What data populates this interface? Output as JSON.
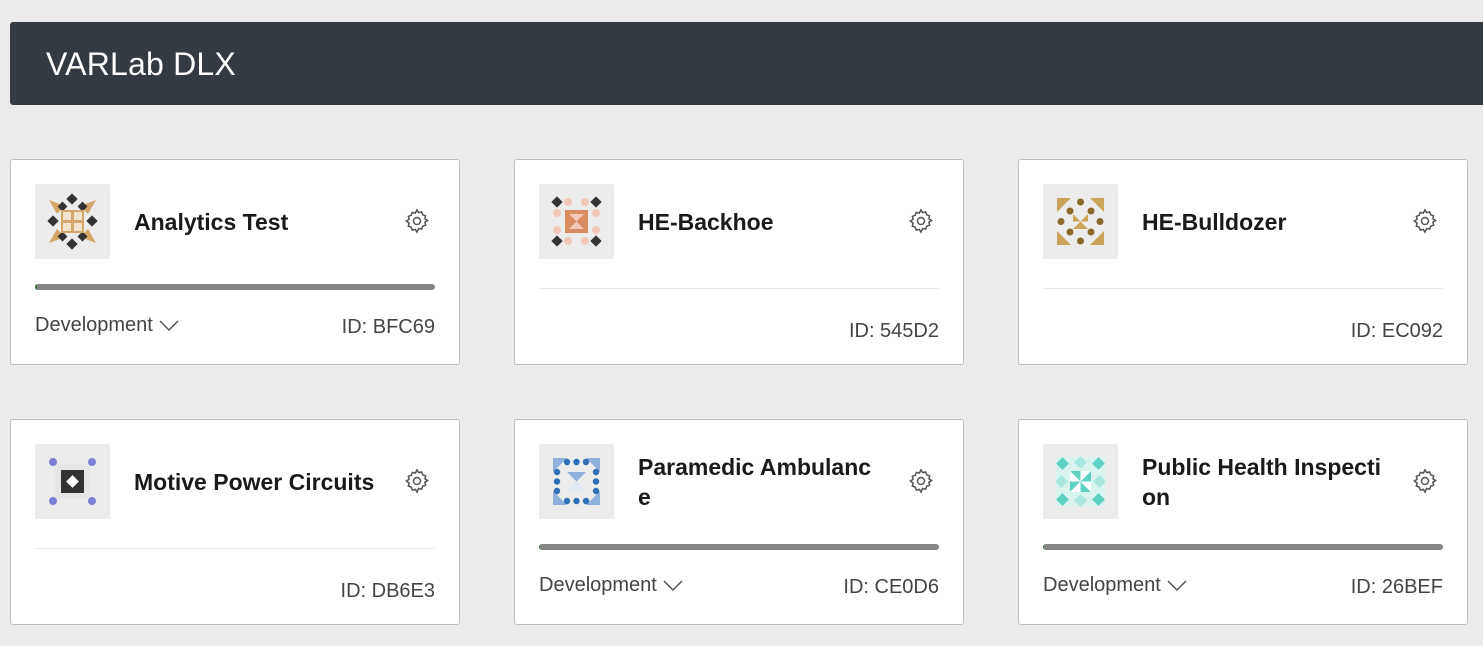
{
  "header": {
    "title": "VARLab DLX"
  },
  "cards": [
    {
      "title": "Analytics Test",
      "stage": "Development",
      "id_text": "ID: BFC69",
      "progress": 0.0,
      "icon": "analytics-test-pattern-icon",
      "colors": [
        "#333333",
        "#d4a66a"
      ]
    },
    {
      "title": "HE-Backhoe",
      "id_text": "ID: 545D2",
      "icon": "he-backhoe-pattern-icon",
      "colors": [
        "#333333",
        "#d98c5f",
        "#f2c9b8"
      ]
    },
    {
      "title": "HE-Bulldozer",
      "id_text": "ID: EC092",
      "icon": "he-bulldozer-pattern-icon",
      "colors": [
        "#8a6a2a",
        "#c9a45a"
      ]
    },
    {
      "title": "Motive Power Circuits",
      "id_text": "ID: DB6E3",
      "icon": "motive-power-pattern-icon",
      "colors": [
        "#333333",
        "#7b7fd6"
      ]
    },
    {
      "title": "Paramedic Ambulance",
      "stage": "Development",
      "id_text": "ID: CE0D6",
      "progress": 0.0,
      "icon": "paramedic-ambulance-pattern-icon",
      "colors": [
        "#2f6fb5",
        "#8fb0dc"
      ]
    },
    {
      "title": "Public Health Inspection",
      "stage": "Development",
      "id_text": "ID: 26BEF",
      "progress": 0.0,
      "icon": "public-health-pattern-icon",
      "colors": [
        "#5fd1c3",
        "#a8e8df"
      ]
    }
  ],
  "icons": {
    "settings": "gear-icon",
    "dropdown": "chevron-down-icon"
  }
}
